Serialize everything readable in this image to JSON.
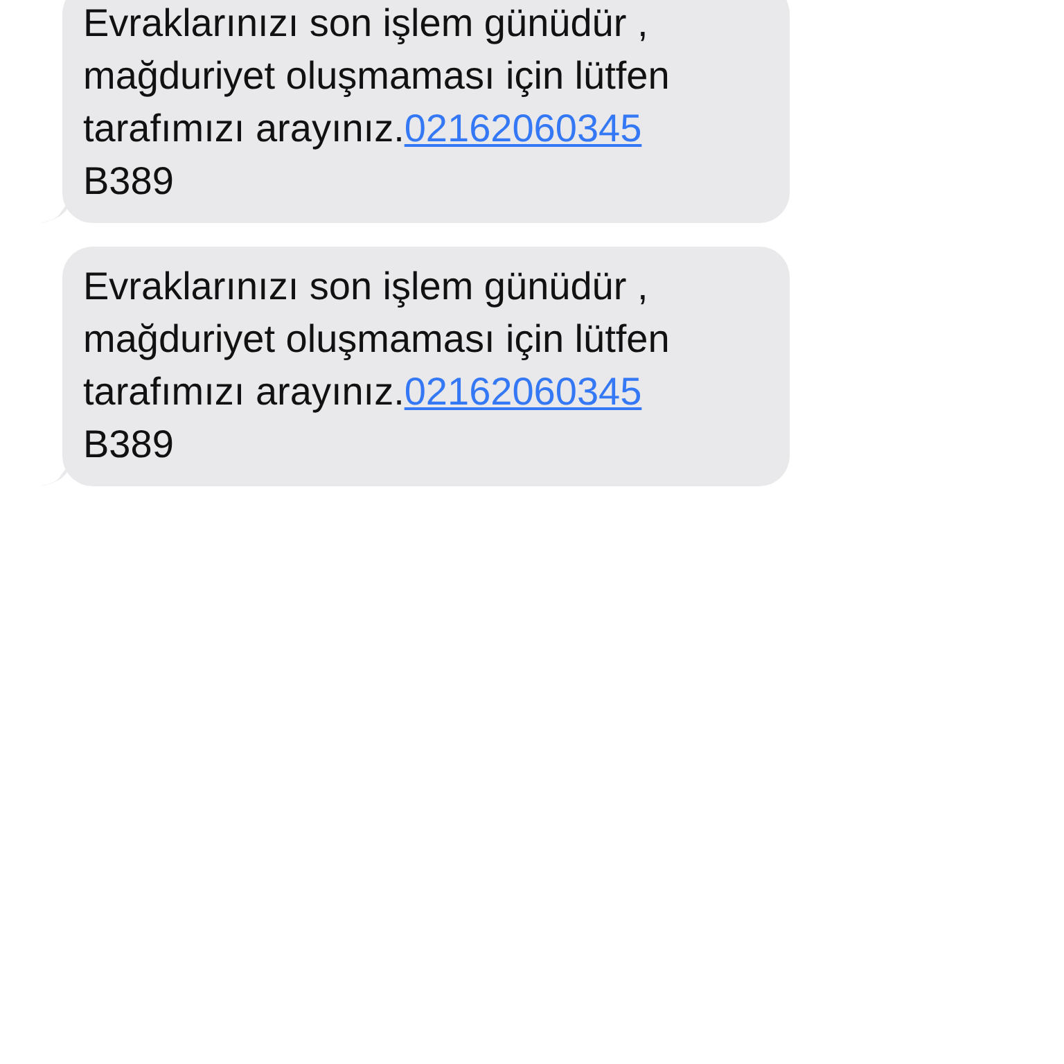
{
  "messages": [
    {
      "lines": [
        "Evraklarınızı son işlem günüdür ,",
        "mağduriyet oluşmaması için lütfen",
        "tarafımızı arayınız."
      ],
      "link": "02162060345",
      "last_line": "B389"
    },
    {
      "lines": [
        "Evraklarınızı son işlem günüdür ,",
        "mağduriyet oluşmaması için lütfen",
        "tarafımızı arayınız."
      ],
      "link": "02162060345",
      "last_line": "B389"
    }
  ]
}
